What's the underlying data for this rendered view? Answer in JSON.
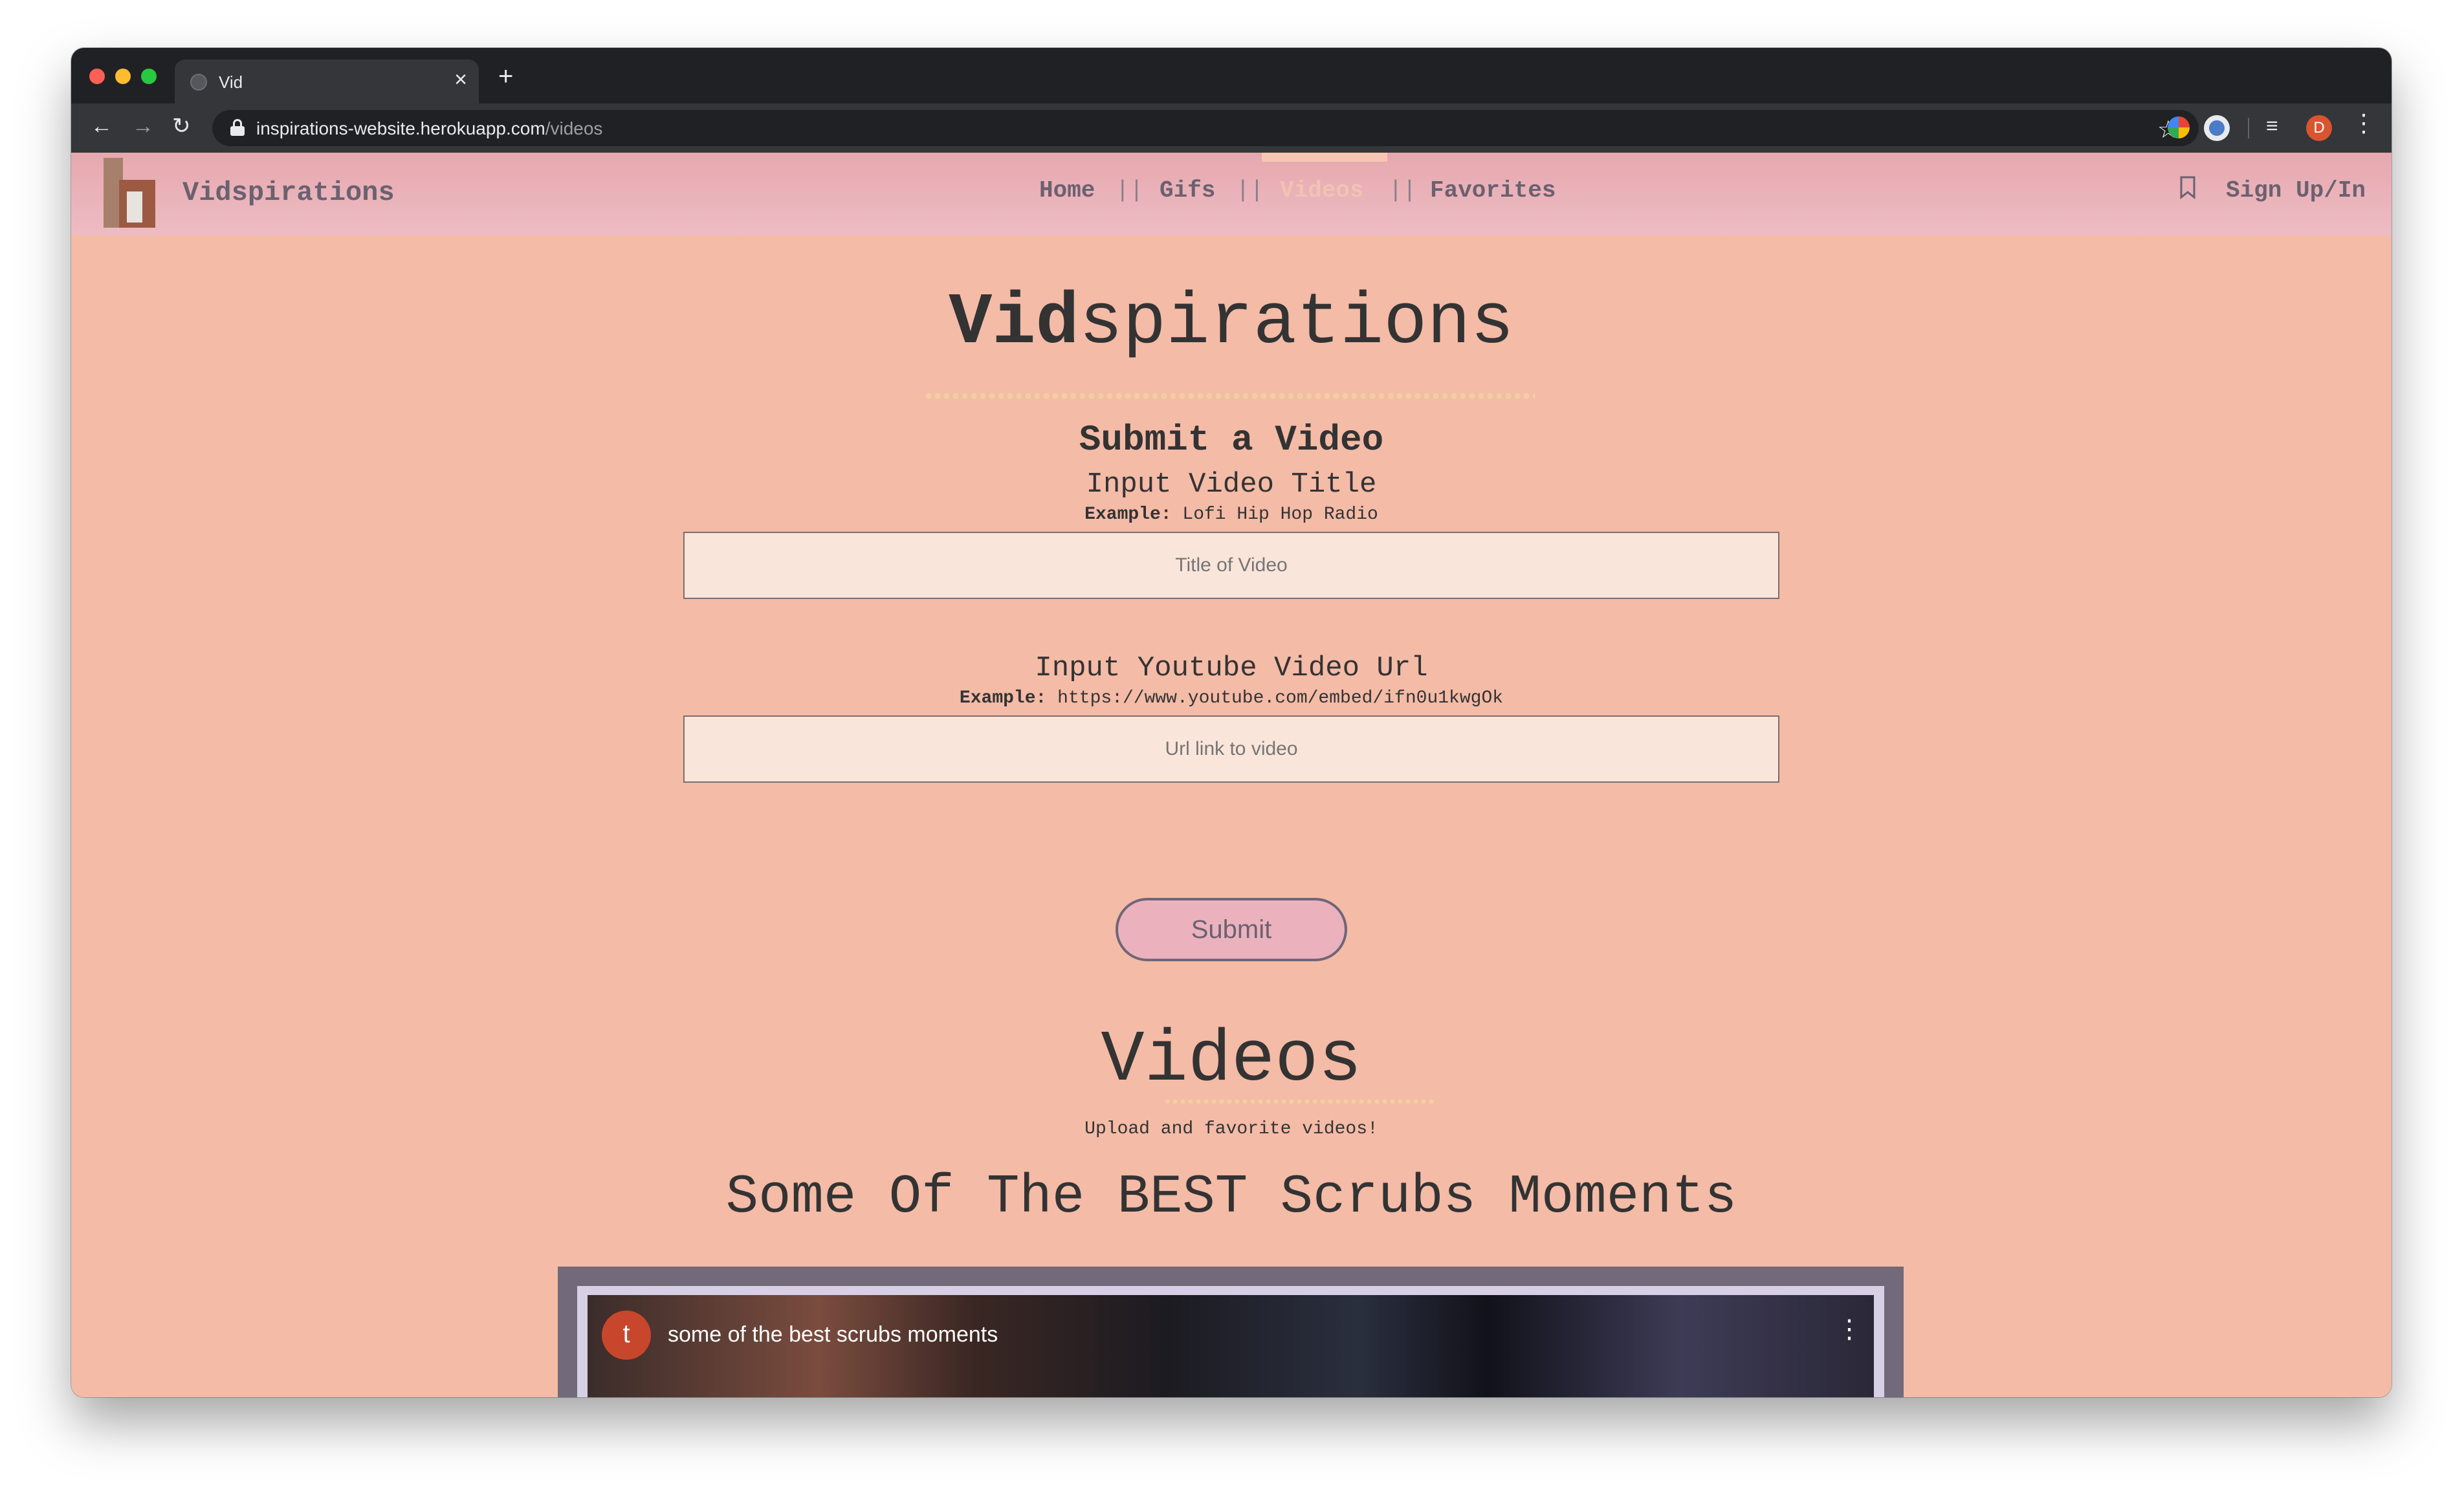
{
  "browser": {
    "tab_title": "Vid",
    "tab_close": "×",
    "new_tab": "+",
    "url_domain": "inspirations-website.herokuapp.com",
    "url_path": "/videos",
    "profile_initial": "D",
    "back": "←",
    "forward": "→",
    "reload": "↻",
    "star": "☆",
    "menu": "⋮",
    "queue": "≡"
  },
  "navbar": {
    "brand": "Vidspirations",
    "links": [
      "Home",
      "Gifs",
      "Videos",
      "Favorites"
    ],
    "separator": "||",
    "active": "Videos",
    "signin": "Sign Up/In"
  },
  "main": {
    "title_bold": "Vid",
    "title_rest": "spirations",
    "submit_title": "Submit a Video",
    "title_label": "Input Video Title",
    "title_example_label": "Example:",
    "title_example": "Lofi Hip Hop Radio",
    "title_placeholder": "Title of Video",
    "url_label": "Input Youtube Video Url",
    "url_example_label": "Example:",
    "url_example": "https://www.youtube.com/embed/ifn0u1kwgOk",
    "url_placeholder": "Url link to video",
    "submit": "Submit"
  },
  "videos": {
    "title": "Videos",
    "subtitle": "Upload and favorite videos!",
    "video_heading": "Some Of The BEST Scrubs Moments",
    "player_title": "some of the best scrubs moments",
    "channel_initial": "t",
    "menu": "⋮"
  }
}
